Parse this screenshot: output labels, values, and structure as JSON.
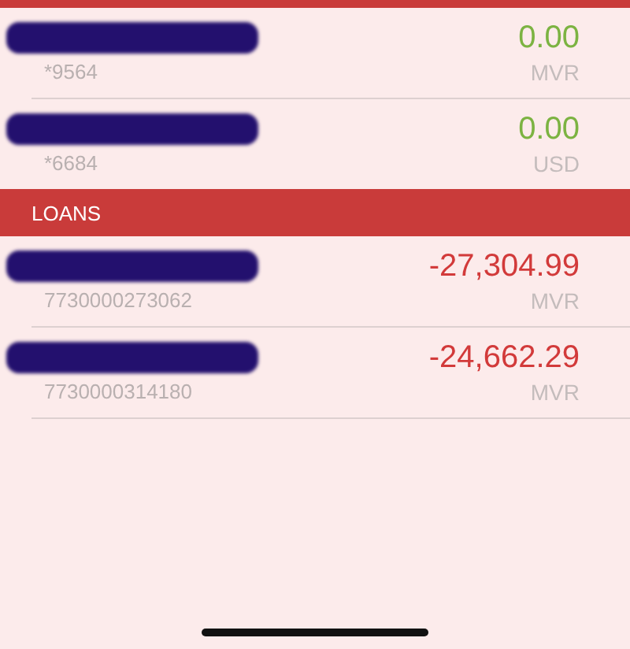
{
  "sections": [
    {
      "accounts": [
        {
          "number": "*9564",
          "amount": "0.00",
          "currency": "MVR",
          "color": "#7cb342"
        },
        {
          "number": "*6684",
          "amount": "0.00",
          "currency": "USD",
          "color": "#7cb342"
        }
      ]
    },
    {
      "title": "LOANS",
      "accounts": [
        {
          "number": "7730000273062",
          "amount": "-27,304.99",
          "currency": "MVR",
          "color": "#d23a3a"
        },
        {
          "number": "7730000314180",
          "amount": "-24,662.29",
          "currency": "MVR",
          "color": "#d23a3a"
        }
      ]
    }
  ]
}
